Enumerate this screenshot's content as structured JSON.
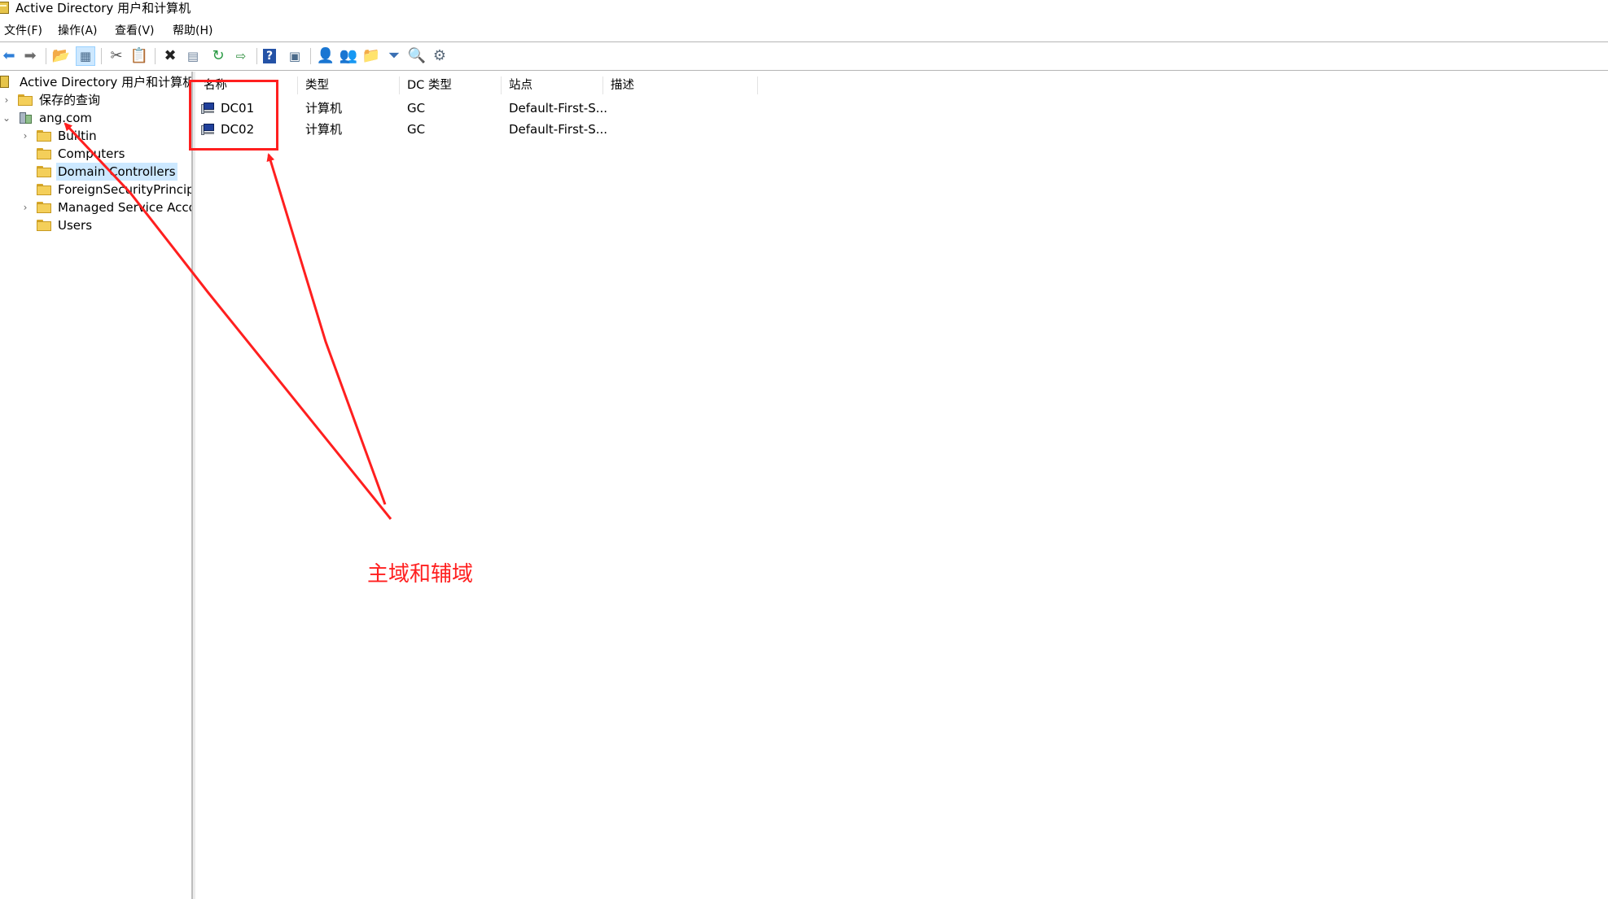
{
  "window": {
    "title": "Active Directory 用户和计算机"
  },
  "menu": [
    {
      "label": "文件(F)"
    },
    {
      "label": "操作(A)"
    },
    {
      "label": "查看(V)"
    },
    {
      "label": "帮助(H)"
    }
  ],
  "toolbar": {
    "buttons": [
      {
        "icon": "back-arrow-icon"
      },
      {
        "icon": "forward-arrow-icon"
      },
      {
        "icon": "up-folder-icon"
      },
      {
        "icon": "show-hide-console-tree-icon"
      },
      {
        "icon": "cut-icon"
      },
      {
        "icon": "paste-icon"
      },
      {
        "icon": "delete-icon"
      },
      {
        "icon": "properties-icon"
      },
      {
        "icon": "refresh-icon"
      },
      {
        "icon": "export-list-icon"
      },
      {
        "icon": "help-icon"
      },
      {
        "icon": "new-window-icon"
      },
      {
        "icon": "new-user-icon"
      },
      {
        "icon": "new-group-icon"
      },
      {
        "icon": "new-ou-icon"
      },
      {
        "icon": "filter-icon"
      },
      {
        "icon": "find-icon"
      },
      {
        "icon": "add-to-group-icon"
      }
    ]
  },
  "tree": {
    "root": "Active Directory 用户和计算机",
    "items": [
      {
        "label": "保存的查询"
      },
      {
        "label": "ang.com"
      },
      {
        "label": "Builtin"
      },
      {
        "label": "Computers"
      },
      {
        "label": "Domain Controllers",
        "selected": true
      },
      {
        "label": "ForeignSecurityPrincipal"
      },
      {
        "label": "Managed Service Accou"
      },
      {
        "label": "Users"
      }
    ]
  },
  "list": {
    "columns": [
      "名称",
      "类型",
      "DC 类型",
      "站点",
      "描述"
    ],
    "rows": [
      {
        "name": "DC01",
        "type": "计算机",
        "dc_type": "GC",
        "site": "Default-First-S...",
        "description": ""
      },
      {
        "name": "DC02",
        "type": "计算机",
        "dc_type": "GC",
        "site": "Default-First-S...",
        "description": ""
      }
    ]
  },
  "annotation": {
    "text": "主域和辅域",
    "color": "#ff1f1f"
  },
  "colors": {
    "selection": "#cce8ff",
    "folder": "#f4cf5a"
  }
}
